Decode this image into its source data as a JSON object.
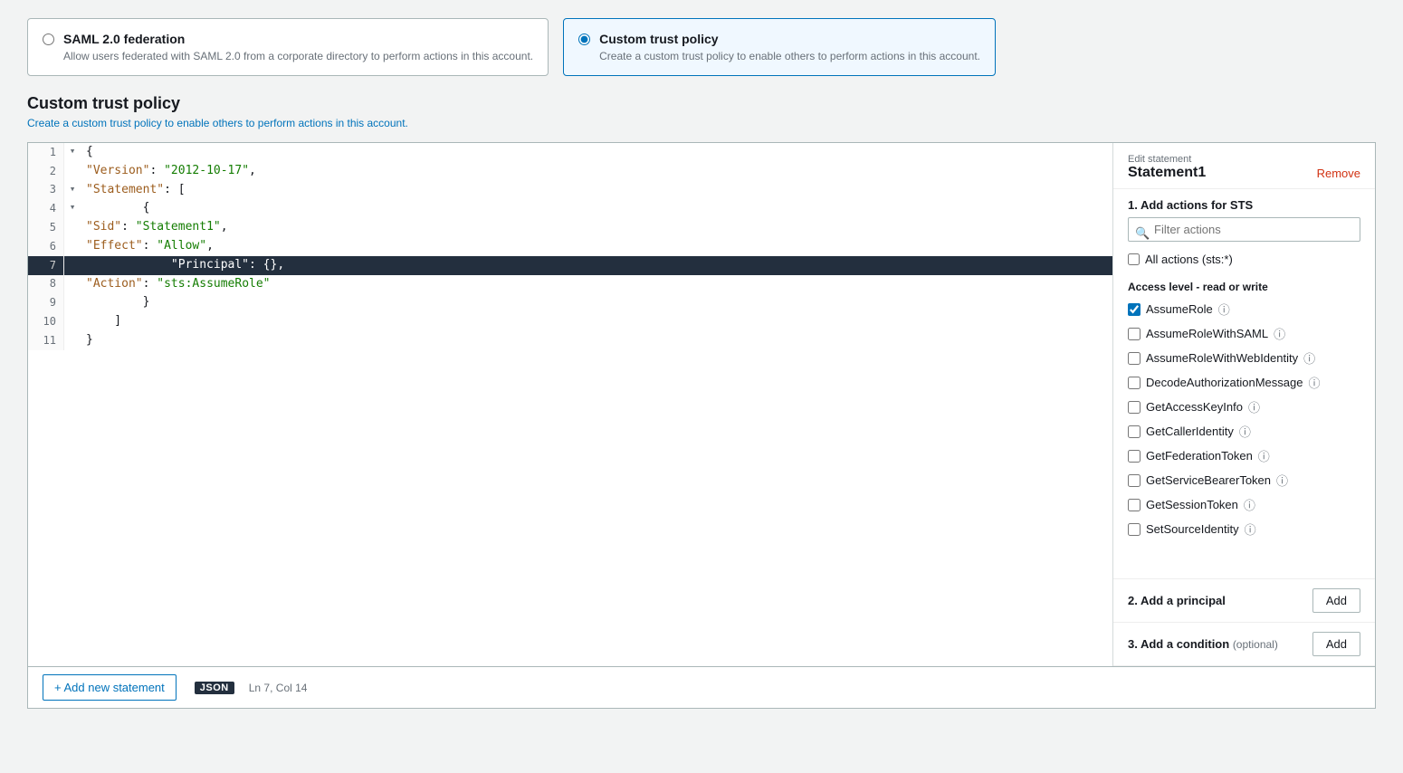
{
  "options": [
    {
      "id": "saml",
      "label": "SAML 2.0 federation",
      "description": "Allow users federated with SAML 2.0 from a corporate directory to perform actions in this account.",
      "selected": false
    },
    {
      "id": "custom",
      "label": "Custom trust policy",
      "description": "Create a custom trust policy to enable others to perform actions in this account.",
      "selected": true
    }
  ],
  "section": {
    "title": "Custom trust policy",
    "subtitle": "Create a custom trust policy to enable others to perform actions in this account."
  },
  "codeEditor": {
    "lines": [
      {
        "num": 1,
        "toggle": "▾",
        "content": "{",
        "highlighted": false
      },
      {
        "num": 2,
        "toggle": "",
        "content": "    \"Version\": \"2012-10-17\",",
        "highlighted": false
      },
      {
        "num": 3,
        "toggle": "▾",
        "content": "    \"Statement\": [",
        "highlighted": false
      },
      {
        "num": 4,
        "toggle": "▾",
        "content": "        {",
        "highlighted": false
      },
      {
        "num": 5,
        "toggle": "",
        "content": "            \"Sid\": \"Statement1\",",
        "highlighted": false
      },
      {
        "num": 6,
        "toggle": "",
        "content": "            \"Effect\": \"Allow\",",
        "highlighted": false
      },
      {
        "num": 7,
        "toggle": "",
        "content": "            \"Principal\": {},",
        "highlighted": true
      },
      {
        "num": 8,
        "toggle": "",
        "content": "            \"Action\": \"sts:AssumeRole\"",
        "highlighted": false
      },
      {
        "num": 9,
        "toggle": "",
        "content": "        }",
        "highlighted": false
      },
      {
        "num": 10,
        "toggle": "",
        "content": "    ]",
        "highlighted": false
      },
      {
        "num": 11,
        "toggle": "",
        "content": "}",
        "highlighted": false
      }
    ]
  },
  "rightPanel": {
    "editLabel": "Edit statement",
    "statementTitle": "Statement1",
    "removeLabel": "Remove",
    "section1Title": "1. Add actions for STS",
    "filterPlaceholder": "Filter actions",
    "allActionsLabel": "All actions (sts:*)",
    "accessLevelTitle": "Access level - read or write",
    "actions": [
      {
        "label": "AssumeRole",
        "checked": true,
        "info": true
      },
      {
        "label": "AssumeRoleWithSAML",
        "checked": false,
        "info": true
      },
      {
        "label": "AssumeRoleWithWebIdentity",
        "checked": false,
        "info": true
      },
      {
        "label": "DecodeAuthorizationMessage",
        "checked": false,
        "info": true
      },
      {
        "label": "GetAccessKeyInfo",
        "checked": false,
        "info": true
      },
      {
        "label": "GetCallerIdentity",
        "checked": false,
        "info": true
      },
      {
        "label": "GetFederationToken",
        "checked": false,
        "info": true
      },
      {
        "label": "GetServiceBearerToken",
        "checked": false,
        "info": true
      },
      {
        "label": "GetSessionToken",
        "checked": false,
        "info": true
      },
      {
        "label": "SetSourceIdentity",
        "checked": false,
        "info": true
      }
    ],
    "section2Title": "2. Add a principal",
    "addPrincipalLabel": "Add",
    "section3Title": "3. Add a condition",
    "section3Optional": "(optional)",
    "addConditionLabel": "Add"
  },
  "bottomBar": {
    "addStatementLabel": "+ Add new statement",
    "jsonBadge": "JSON",
    "cursorInfo": "Ln 7, Col 14"
  }
}
